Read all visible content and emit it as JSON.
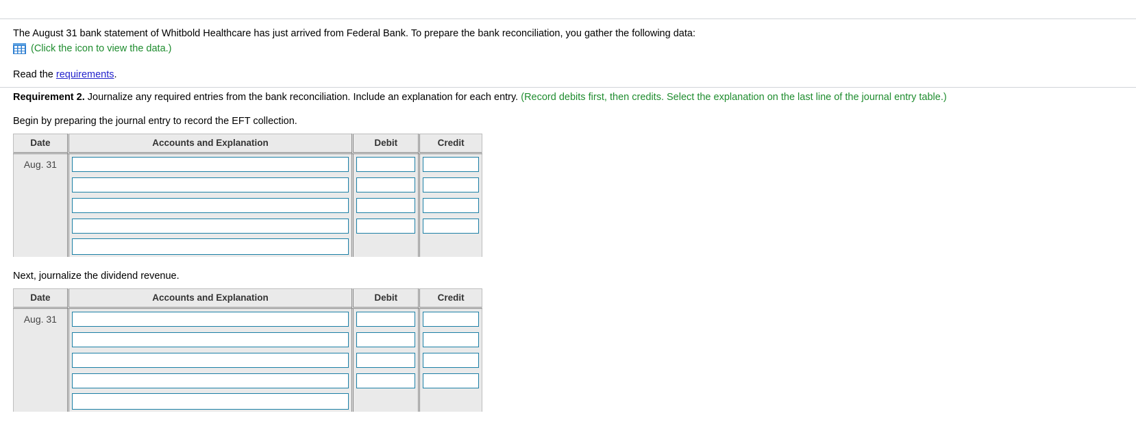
{
  "problem": {
    "intro": "The August 31 bank statement of Whitbold Healthcare has just arrived from Federal Bank. To prepare the bank reconciliation, you gather the following data:",
    "icon_name": "data-table-icon",
    "icon_hint": "(Click the icon to view the data.)",
    "read_prefix": "Read the ",
    "read_link": "requirements",
    "read_suffix": "."
  },
  "requirement": {
    "label": "Requirement 2.",
    "body": " Journalize any required entries from the bank reconciliation. Include an explanation for each entry. ",
    "hint": "(Record debits first, then credits. Select the explanation on the last line of the journal entry table.)"
  },
  "sections": [
    {
      "instruction": "Begin by preparing the journal entry to record the EFT collection.",
      "table": {
        "headers": [
          "Date",
          "Accounts and Explanation",
          "Debit",
          "Credit"
        ],
        "date_value": "Aug. 31",
        "rows": [
          {
            "accounts": "",
            "debit": "",
            "credit": "",
            "has_amounts": true
          },
          {
            "accounts": "",
            "debit": "",
            "credit": "",
            "has_amounts": true
          },
          {
            "accounts": "",
            "debit": "",
            "credit": "",
            "has_amounts": true
          },
          {
            "accounts": "",
            "debit": "",
            "credit": "",
            "has_amounts": true
          },
          {
            "accounts": "",
            "debit": "",
            "credit": "",
            "has_amounts": false
          }
        ]
      }
    },
    {
      "instruction": "Next, journalize the dividend revenue.",
      "table": {
        "headers": [
          "Date",
          "Accounts and Explanation",
          "Debit",
          "Credit"
        ],
        "date_value": "Aug. 31",
        "rows": [
          {
            "accounts": "",
            "debit": "",
            "credit": "",
            "has_amounts": true
          },
          {
            "accounts": "",
            "debit": "",
            "credit": "",
            "has_amounts": true
          },
          {
            "accounts": "",
            "debit": "",
            "credit": "",
            "has_amounts": true
          },
          {
            "accounts": "",
            "debit": "",
            "credit": "",
            "has_amounts": true
          },
          {
            "accounts": "",
            "debit": "",
            "credit": "",
            "has_amounts": false
          }
        ]
      }
    }
  ],
  "colors": {
    "green_hint": "#1e8c2e",
    "link_blue": "#2222cc",
    "input_border": "#1b7fa5",
    "header_bg": "#eaeaea",
    "icon_blue": "#2f7fd1"
  }
}
